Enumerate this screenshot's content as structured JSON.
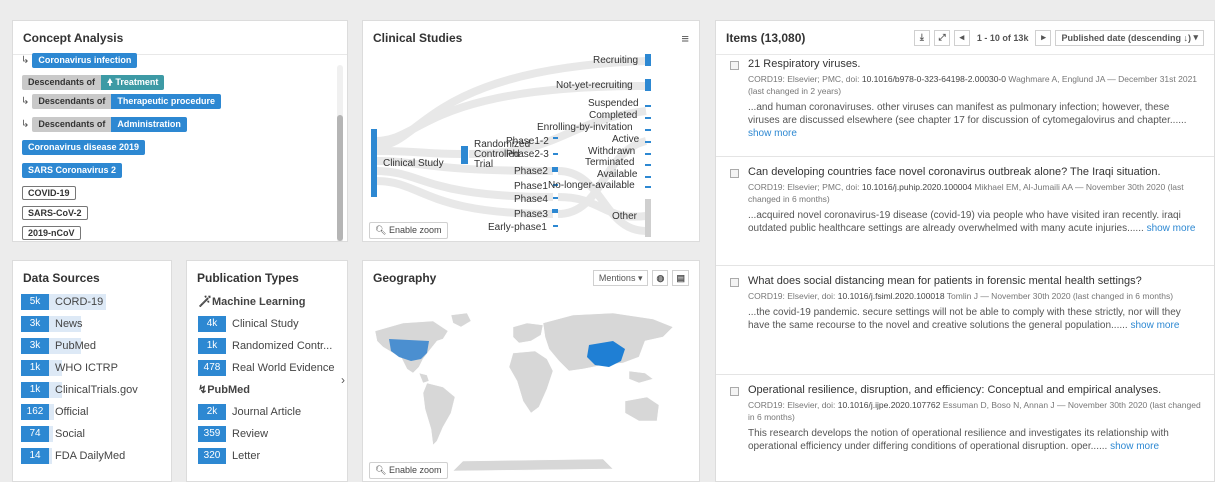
{
  "concept_analysis": {
    "title": "Concept Analysis",
    "tags": {
      "coronavirus_infection": "Coronavirus infection",
      "descendants_of": "Descendants of",
      "treatment": "Treatment",
      "therapeutic_procedure": "Therapeutic procedure",
      "administration": "Administration",
      "coronavirus_disease_2019": "Coronavirus disease 2019",
      "sars_coronavirus_2": "SARS Coronavirus 2",
      "covid_19": "COVID-19",
      "sars_cov_2": "SARS-CoV-2",
      "ncov_2019": "2019-nCoV"
    }
  },
  "clinical_studies": {
    "title": "Clinical Studies",
    "zoom_label": "Enable zoom",
    "labels": {
      "clinical_study": "Clinical Study",
      "randomized": "Randomized",
      "controlled": "Controlled",
      "trial": "Trial",
      "phase12": "Phase1-2",
      "phase23": "Phase2-3",
      "phase2": "Phase2",
      "phase1": "Phase1",
      "phase4": "Phase4",
      "phase3": "Phase3",
      "early_phase1": "Early-phase1",
      "recruiting": "Recruiting",
      "not_yet_recruiting": "Not-yet-recruiting",
      "suspended": "Suspended",
      "completed": "Completed",
      "enrolling": "Enrolling-by-invitation",
      "active": "Active",
      "withdrawn": "Withdrawn",
      "terminated": "Terminated",
      "available": "Available",
      "no_longer_available": "No-longer-available",
      "other": "Other"
    }
  },
  "data_sources": {
    "title": "Data Sources",
    "rows": [
      {
        "count": "5k",
        "label": "CORD-19",
        "fraction": 1.0
      },
      {
        "count": "3k",
        "label": "News",
        "fraction": 0.55
      },
      {
        "count": "3k",
        "label": "PubMed",
        "fraction": 0.55
      },
      {
        "count": "1k",
        "label": "WHO ICTRP",
        "fraction": 0.2
      },
      {
        "count": "1k",
        "label": "ClinicalTrials.gov",
        "fraction": 0.2
      },
      {
        "count": "162",
        "label": "Official",
        "fraction": 0.05
      },
      {
        "count": "74",
        "label": "Social",
        "fraction": 0.03
      },
      {
        "count": "14",
        "label": "FDA DailyMed",
        "fraction": 0.01
      }
    ]
  },
  "publication_types": {
    "title": "Publication Types",
    "groups": [
      {
        "name": "Machine Learning",
        "rows": [
          {
            "count": "4k",
            "label": "Clinical Study"
          },
          {
            "count": "1k",
            "label": "Randomized Contr..."
          },
          {
            "count": "478",
            "label": "Real World Evidence"
          }
        ]
      },
      {
        "name": "PubMed",
        "rows": [
          {
            "count": "2k",
            "label": "Journal Article"
          },
          {
            "count": "359",
            "label": "Review"
          },
          {
            "count": "320",
            "label": "Letter"
          }
        ]
      }
    ]
  },
  "geography": {
    "title": "Geography",
    "dropdown": "Mentions",
    "zoom_label": "Enable zoom"
  },
  "items": {
    "title": "Items (13,080)",
    "pager": "1 - 10 of 13k",
    "sort": "Published date (descending ↓)",
    "list": [
      {
        "title": "21 Respiratory viruses.",
        "meta_prefix": "CORD19: Elsevier; PMC, doi: ",
        "doi": "10.1016/b978-0-323-64198-2.00030-0",
        "meta_suffix": " Waghmare A, Englund JA — December 31st 2021 (last changed in 2 years)",
        "snippet": "...and human coronaviruses. other viruses can manifest as pulmonary infection; however, these viruses are discussed elsewhere (see chapter 17 for discussion of cytomegalovirus and chapter......",
        "more": "show more"
      },
      {
        "title": "Can developing countries face novel coronavirus outbreak alone? The Iraqi situation.",
        "meta_prefix": "CORD19: Elsevier; PMC, doi: ",
        "doi": "10.1016/j.puhip.2020.100004",
        "meta_suffix": " Mikhael EM, Al-Jumaili AA — November 30th 2020 (last changed in 6 months)",
        "snippet": "...acquired novel coronavirus-19 disease (covid-19) via people who have visited iran recently. iraqi outdated public healthcare settings are already overwhelmed with many acute injuries......",
        "more": "show more"
      },
      {
        "title": "What does social distancing mean for patients in forensic mental health settings?",
        "meta_prefix": "CORD19: Elsevier, doi: ",
        "doi": "10.1016/j.fsiml.2020.100018",
        "meta_suffix": " Tomlin J — November 30th 2020 (last changed in 6 months)",
        "snippet": "...the covid-19 pandemic. secure settings will not be able to comply with these strictly, nor will they have the same recourse to the novel and creative solutions the general population......",
        "more": "show more"
      },
      {
        "title": "Operational resilience, disruption, and efficiency: Conceptual and empirical analyses.",
        "meta_prefix": "CORD19: Elsevier, doi: ",
        "doi": "10.1016/j.ijpe.2020.107762",
        "meta_suffix": " Essuman D, Boso N, Annan J — November 30th 2020 (last changed in 6 months)",
        "snippet": "This research develops the notion of operational resilience and investigates its relationship with operational efficiency under differing conditions of operational disruption. oper......",
        "more": "show more"
      }
    ]
  },
  "colors": {
    "accent": "#2d88d2",
    "teal": "#3d9aa5",
    "china": "#1f7fd4",
    "usa": "#4b8fd0"
  }
}
